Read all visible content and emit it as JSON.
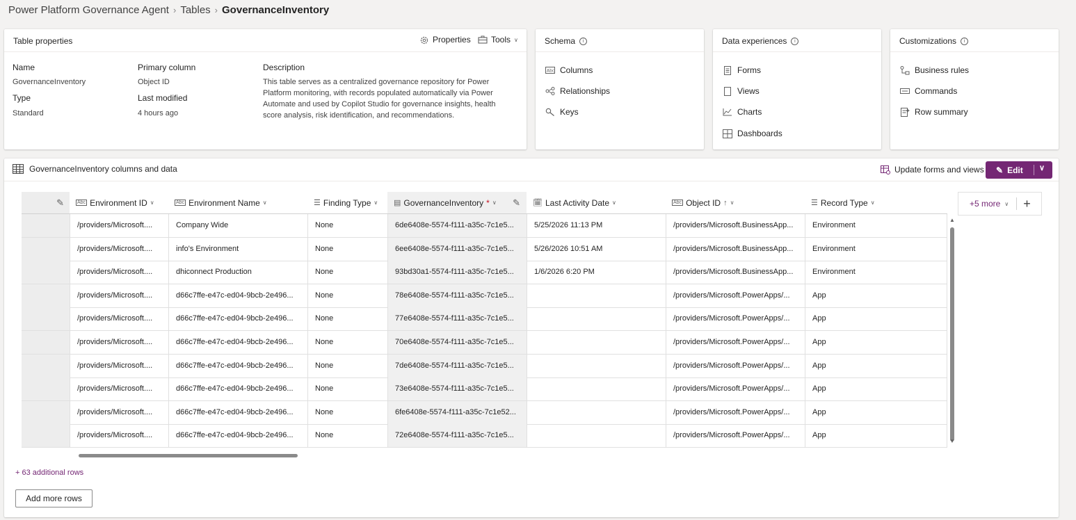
{
  "breadcrumb": [
    "Power Platform Governance Agent",
    "Tables",
    "GovernanceInventory"
  ],
  "table_properties": {
    "title": "Table properties",
    "properties_label": "Properties",
    "tools_label": "Tools",
    "name_label": "Name",
    "name_value": "GovernanceInventory",
    "type_label": "Type",
    "type_value": "Standard",
    "primary_label": "Primary column",
    "primary_value": "Object ID",
    "modified_label": "Last modified",
    "modified_value": "4 hours ago",
    "description_label": "Description",
    "description_lines": [
      "This table serves as a centralized governance repository for Power",
      "Platform monitoring, with records populated automatically via Power",
      "Automate and used by Copilot Studio for governance insights, health",
      "score analysis, risk identification, and recommendations."
    ]
  },
  "schema": {
    "title": "Schema",
    "items": [
      "Columns",
      "Relationships",
      "Keys"
    ]
  },
  "data_experiences": {
    "title": "Data experiences",
    "items": [
      "Forms",
      "Views",
      "Charts",
      "Dashboards"
    ]
  },
  "customizations": {
    "title": "Customizations",
    "items": [
      "Business rules",
      "Commands",
      "Row summary"
    ]
  },
  "data_panel": {
    "title": "GovernanceInventory columns and data",
    "update_label": "Update forms and views",
    "edit_label": "Edit",
    "more_label": "+5 more",
    "additional_rows": "+ 63 additional rows",
    "add_rows_label": "Add more rows"
  },
  "columns": [
    "Environment ID",
    "Environment Name",
    "Finding Type",
    "GovernanceInventory",
    "Last Activity Date",
    "Object ID",
    "Record Type"
  ],
  "rows": [
    [
      "/providers/Microsoft....",
      "Company Wide",
      "None",
      "6de6408e-5574-f111-a35c-7c1e5...",
      "5/25/2026 11:13 PM",
      "/providers/Microsoft.BusinessApp...",
      "Environment"
    ],
    [
      "/providers/Microsoft....",
      "info's Environment",
      "None",
      "6ee6408e-5574-f111-a35c-7c1e5...",
      "5/26/2026 10:51 AM",
      "/providers/Microsoft.BusinessApp...",
      "Environment"
    ],
    [
      "/providers/Microsoft....",
      "dhiconnect Production",
      "None",
      "93bd30a1-5574-f111-a35c-7c1e5...",
      "1/6/2026 6:20 PM",
      "/providers/Microsoft.BusinessApp...",
      "Environment"
    ],
    [
      "/providers/Microsoft....",
      "d66c7ffe-e47c-ed04-9bcb-2e496...",
      "None",
      "78e6408e-5574-f111-a35c-7c1e5...",
      "",
      "/providers/Microsoft.PowerApps/...",
      "App"
    ],
    [
      "/providers/Microsoft....",
      "d66c7ffe-e47c-ed04-9bcb-2e496...",
      "None",
      "77e6408e-5574-f111-a35c-7c1e5...",
      "",
      "/providers/Microsoft.PowerApps/...",
      "App"
    ],
    [
      "/providers/Microsoft....",
      "d66c7ffe-e47c-ed04-9bcb-2e496...",
      "None",
      "70e6408e-5574-f111-a35c-7c1e5...",
      "",
      "/providers/Microsoft.PowerApps/...",
      "App"
    ],
    [
      "/providers/Microsoft....",
      "d66c7ffe-e47c-ed04-9bcb-2e496...",
      "None",
      "7de6408e-5574-f111-a35c-7c1e5...",
      "",
      "/providers/Microsoft.PowerApps/...",
      "App"
    ],
    [
      "/providers/Microsoft....",
      "d66c7ffe-e47c-ed04-9bcb-2e496...",
      "None",
      "73e6408e-5574-f111-a35c-7c1e5...",
      "",
      "/providers/Microsoft.PowerApps/...",
      "App"
    ],
    [
      "/providers/Microsoft....",
      "d66c7ffe-e47c-ed04-9bcb-2e496...",
      "None",
      "6fe6408e-5574-f111-a35c-7c1e52...",
      "",
      "/providers/Microsoft.PowerApps/...",
      "App"
    ],
    [
      "/providers/Microsoft....",
      "d66c7ffe-e47c-ed04-9bcb-2e496...",
      "None",
      "72e6408e-5574-f111-a35c-7c1e5...",
      "",
      "/providers/Microsoft.PowerApps/...",
      "App"
    ]
  ],
  "colors": {
    "accent": "#742774",
    "link": "#742774"
  }
}
